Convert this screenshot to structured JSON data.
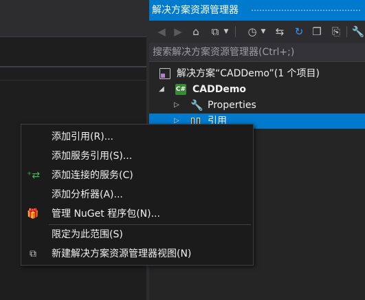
{
  "solution_explorer": {
    "title": "解决方案资源管理器",
    "search_placeholder": "搜索解决方案资源管理器(Ctrl+;)",
    "toolbar_icons": [
      "back-icon",
      "forward-icon",
      "home-icon",
      "switch-views-icon",
      "history-icon",
      "sync-icon",
      "refresh-icon",
      "collapse-all-icon",
      "show-all-files-icon",
      "properties-icon"
    ],
    "tree": {
      "solution": "解决方案“CADDemo”(1 个项目)",
      "project": "CADDemo",
      "project_badge": "C#",
      "properties": "Properties",
      "references": "引用"
    }
  },
  "context_menu": {
    "items": [
      {
        "label": "添加引用(R)...",
        "icon": ""
      },
      {
        "label": "添加服务引用(S)...",
        "icon": ""
      },
      {
        "label": "添加连接的服务(C)",
        "icon": "connected-service-icon"
      },
      {
        "label": "添加分析器(A)...",
        "icon": ""
      },
      {
        "label": "管理 NuGet 程序包(N)...",
        "icon": "nuget-package-icon"
      },
      {
        "label": "限定为此范围(S)",
        "icon": ""
      },
      {
        "label": "新建解决方案资源管理器视图(N)",
        "icon": "new-view-icon"
      }
    ]
  },
  "colors": {
    "accent": "#007acc",
    "menu_bg": "#1b1b1c",
    "panel_bg": "#252526",
    "editor_bg": "#1e1e1e"
  }
}
